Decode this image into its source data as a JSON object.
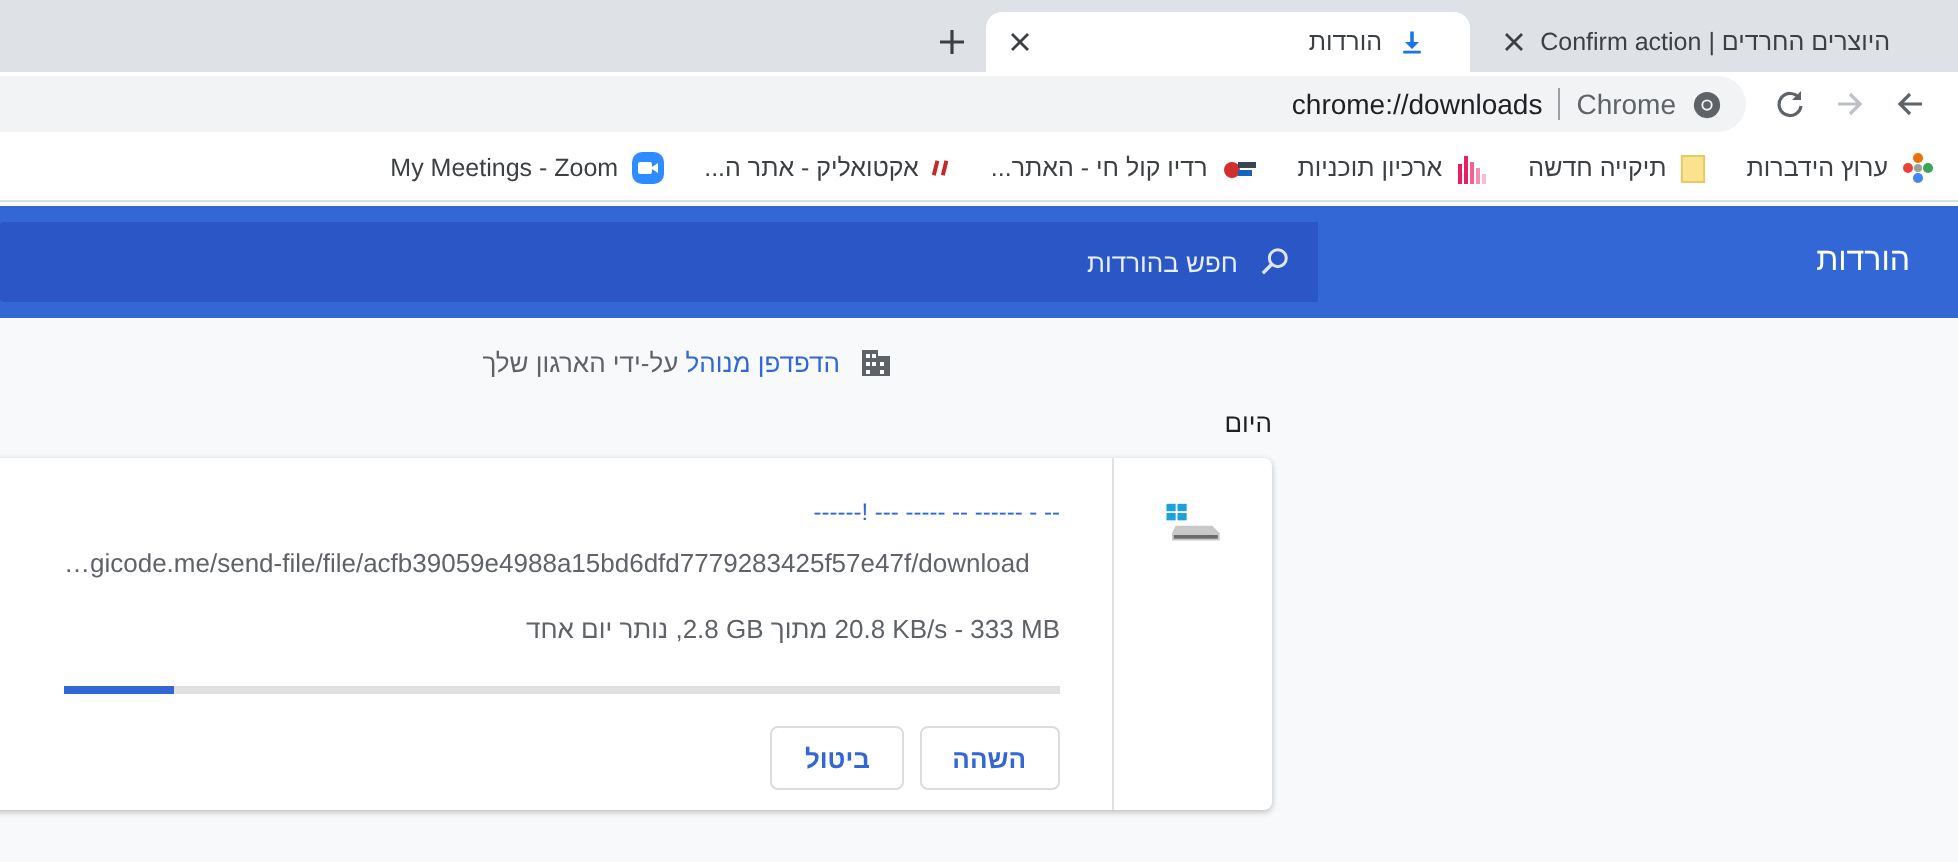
{
  "tabs": [
    {
      "title": "היוצרים החרדים | Confirm action",
      "selected": false,
      "kind": "page"
    },
    {
      "title": "הורדות",
      "selected": true,
      "kind": "download"
    }
  ],
  "toolbar": {
    "back": {
      "disabled": false
    },
    "forward": {
      "disabled": true
    },
    "omnibox": {
      "chip": "Chrome",
      "url": "chrome://downloads"
    }
  },
  "bookmarks": [
    {
      "title": "ערוץ הידברות",
      "kind": "flower"
    },
    {
      "title": "תיקייה חדשה",
      "kind": "folder"
    },
    {
      "title": "ארכיון תוכניות",
      "kind": "bars"
    },
    {
      "title": "רדיו קול חי - האתר...",
      "kind": "radio"
    },
    {
      "title": "אקטואליק - אתר ה...",
      "kind": "slash"
    },
    {
      "title": "My Meetings - Zoom",
      "kind": "camera"
    }
  ],
  "header": {
    "title": "הורדות",
    "search": {
      "placeholder": "חפש בהורדות"
    }
  },
  "managed_notice": {
    "link": "הדפדפן מנוהל",
    "text": "על-ידי הארגון שלך"
  },
  "section": "היום",
  "download": {
    "name": "-- - ------ -- ----- --- !------",
    "url": "…gicode.me/send-file/file/acfb39059e4988a15bd6dfd7779283425f57e47f/download",
    "status": "‎20.8 KB/s - 333 MB‎ מתוך ‎2.8 GB‎, נותר יום אחד",
    "level": 0.11,
    "buttons": [
      {
        "label": "השהה"
      },
      {
        "label": "ביטול"
      }
    ]
  }
}
